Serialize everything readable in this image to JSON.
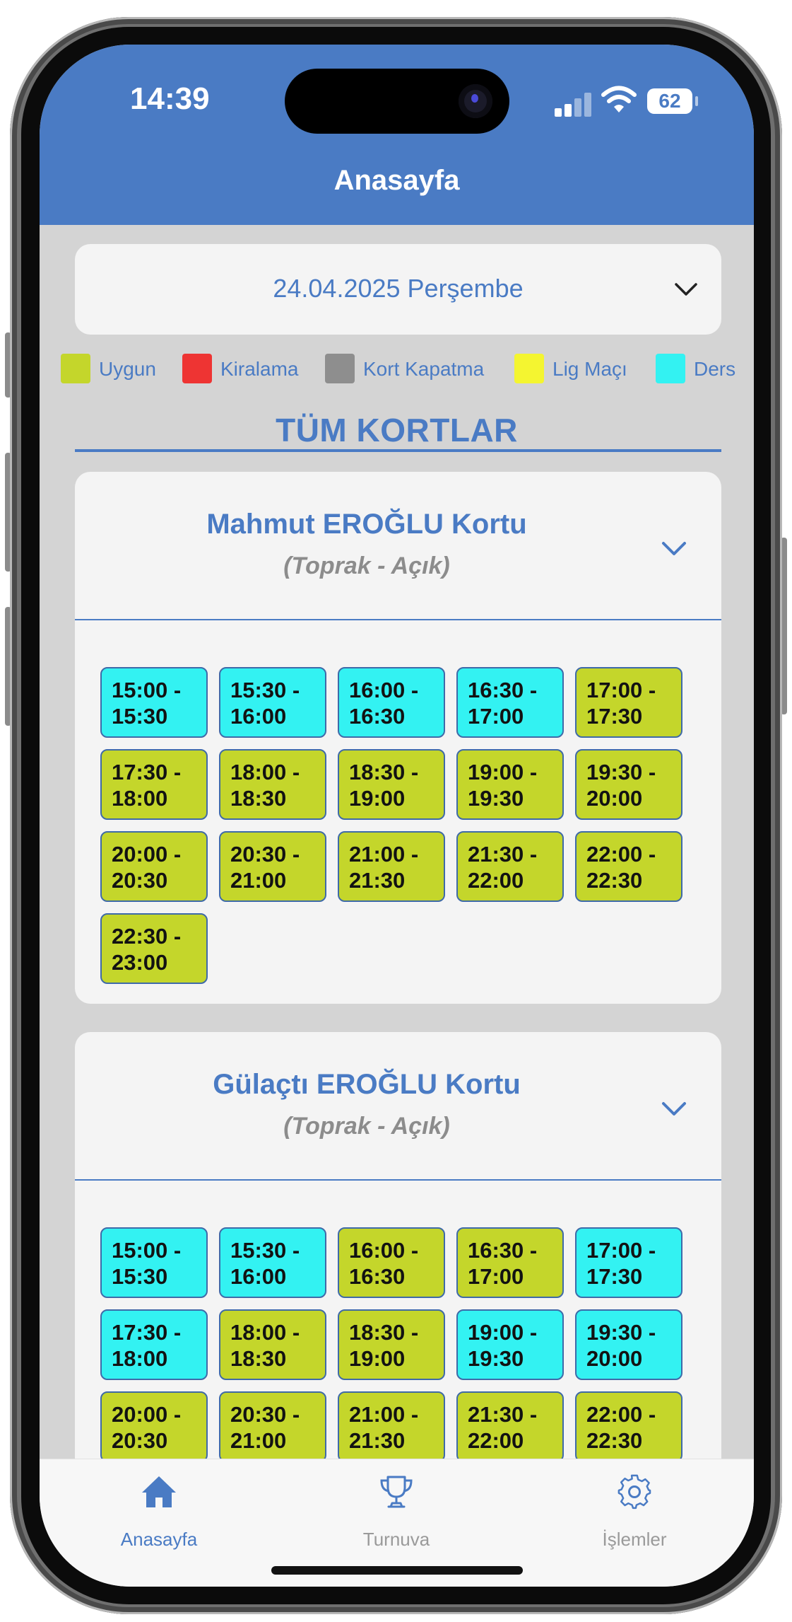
{
  "status_bar": {
    "time": "14:39",
    "battery": "62"
  },
  "header": {
    "title": "Anasayfa"
  },
  "date_picker": {
    "value": "24.04.2025 Perşembe"
  },
  "legend": [
    {
      "label": "Uygun",
      "color": "#c4d62b"
    },
    {
      "label": "Kiralama",
      "color": "#ee3433"
    },
    {
      "label": "Kort Kapatma",
      "color": "#8e8e8e"
    },
    {
      "label": "Lig Maçı",
      "color": "#f4f530"
    },
    {
      "label": "Ders",
      "color": "#33f2f2"
    }
  ],
  "section_title": "TÜM KORTLAR",
  "courts": [
    {
      "name": "Mahmut EROĞLU Kortu",
      "surface": "(Toprak - Açık)",
      "slots": [
        {
          "label": "15:00 -\n15:30",
          "status": "Ders"
        },
        {
          "label": "15:30 -\n16:00",
          "status": "Ders"
        },
        {
          "label": "16:00 -\n16:30",
          "status": "Ders"
        },
        {
          "label": "16:30 -\n17:00",
          "status": "Ders"
        },
        {
          "label": "17:00 -\n17:30",
          "status": "Uygun"
        },
        {
          "label": "17:30 -\n18:00",
          "status": "Uygun"
        },
        {
          "label": "18:00 -\n18:30",
          "status": "Uygun"
        },
        {
          "label": "18:30 -\n19:00",
          "status": "Uygun"
        },
        {
          "label": "19:00 -\n19:30",
          "status": "Uygun"
        },
        {
          "label": "19:30 -\n20:00",
          "status": "Uygun"
        },
        {
          "label": "20:00 -\n20:30",
          "status": "Uygun"
        },
        {
          "label": "20:30 -\n21:00",
          "status": "Uygun"
        },
        {
          "label": "21:00 -\n21:30",
          "status": "Uygun"
        },
        {
          "label": "21:30 -\n22:00",
          "status": "Uygun"
        },
        {
          "label": "22:00 -\n22:30",
          "status": "Uygun"
        },
        {
          "label": "22:30 -\n23:00",
          "status": "Uygun"
        }
      ]
    },
    {
      "name": "Gülaçtı EROĞLU Kortu",
      "surface": "(Toprak - Açık)",
      "slots": [
        {
          "label": "15:00 -\n15:30",
          "status": "Ders"
        },
        {
          "label": "15:30 -\n16:00",
          "status": "Ders"
        },
        {
          "label": "16:00 -\n16:30",
          "status": "Uygun"
        },
        {
          "label": "16:30 -\n17:00",
          "status": "Uygun"
        },
        {
          "label": "17:00 -\n17:30",
          "status": "Ders"
        },
        {
          "label": "17:30 -\n18:00",
          "status": "Ders"
        },
        {
          "label": "18:00 -\n18:30",
          "status": "Uygun"
        },
        {
          "label": "18:30 -\n19:00",
          "status": "Uygun"
        },
        {
          "label": "19:00 -\n19:30",
          "status": "Ders"
        },
        {
          "label": "19:30 -\n20:00",
          "status": "Ders"
        },
        {
          "label": "20:00 -\n20:30",
          "status": "Uygun"
        },
        {
          "label": "20:30 -\n21:00",
          "status": "Uygun"
        },
        {
          "label": "21:00 -\n21:30",
          "status": "Uygun"
        },
        {
          "label": "21:30 -\n22:00",
          "status": "Uygun"
        },
        {
          "label": "22:00 -\n22:30",
          "status": "Uygun"
        }
      ]
    }
  ],
  "tabbar": [
    {
      "label": "Anasayfa",
      "icon": "home-icon",
      "active": true
    },
    {
      "label": "Turnuva",
      "icon": "trophy-icon",
      "active": false
    },
    {
      "label": "İşlemler",
      "icon": "gear-icon",
      "active": false
    }
  ],
  "colors": {
    "accent": "#4a7bc4",
    "inactive": "#9a9a9a"
  }
}
